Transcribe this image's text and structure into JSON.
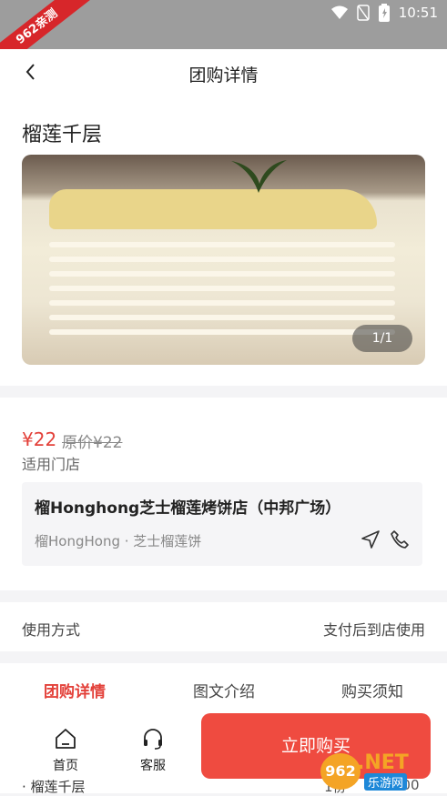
{
  "status_bar": {
    "time": "10:51",
    "corner_badge": "962亲测",
    "icons": [
      "wifi-icon",
      "no-sim-icon",
      "battery-icon"
    ]
  },
  "header": {
    "title": "团购详情",
    "back_icon": "chevron-left-icon"
  },
  "product": {
    "name": "榴莲千层",
    "image_counter": "1/1"
  },
  "pricing": {
    "price": "¥22",
    "original_price": "原价¥22",
    "stores_label": "适用门店",
    "store": {
      "name": "榴Honghong芝士榴莲烤饼店（中邦广场）",
      "subtitle": "榴HongHong · 芝士榴莲饼"
    }
  },
  "usage": {
    "label": "使用方式",
    "value": "支付后到店使用"
  },
  "tabs": [
    {
      "label": "团购详情",
      "active": true
    },
    {
      "label": "图文介绍",
      "active": false
    },
    {
      "label": "购买须知",
      "active": false
    }
  ],
  "detail_row": {
    "item": "· 榴莲千层",
    "qty": "1份",
    "amount": "¥22.00"
  },
  "bottom_bar": {
    "home_label": "首页",
    "service_label": "客服",
    "buy_label": "立即购买"
  },
  "watermark": {
    "badge": "962",
    "net": ".NET",
    "cn": "乐游网"
  },
  "colors": {
    "accent": "#e3413a",
    "buy_button": "#ef4b40",
    "status_bar": "#9d9d9d"
  }
}
